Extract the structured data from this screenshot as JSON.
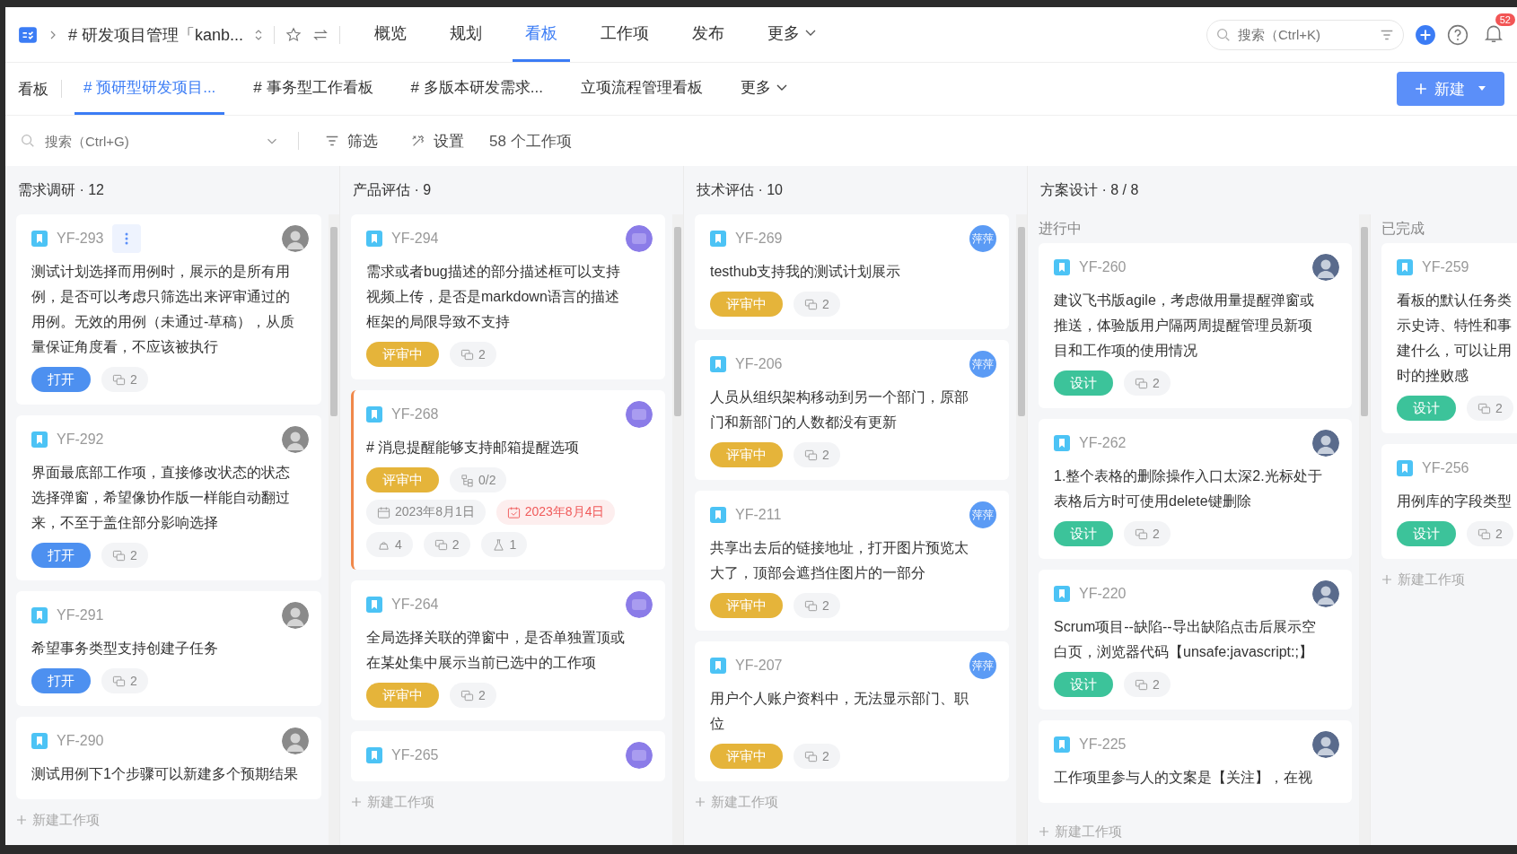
{
  "topbar": {
    "breadcrumb": "# 研发项目管理「kanb...",
    "nav": [
      {
        "label": "概览",
        "selected": false,
        "dropdown": false
      },
      {
        "label": "规划",
        "selected": false,
        "dropdown": false
      },
      {
        "label": "看板",
        "selected": true,
        "dropdown": false
      },
      {
        "label": "工作项",
        "selected": false,
        "dropdown": false
      },
      {
        "label": "发布",
        "selected": false,
        "dropdown": false
      },
      {
        "label": "更多",
        "selected": false,
        "dropdown": true
      }
    ],
    "search": {
      "placeholder": "搜索（Ctrl+K)"
    },
    "notifications": "52"
  },
  "board_tabs": {
    "label": "看板",
    "tabs": [
      {
        "label": "# 预研型研发项目...",
        "selected": true
      },
      {
        "label": "# 事务型工作看板",
        "selected": false
      },
      {
        "label": "# 多版本研发需求...",
        "selected": false
      },
      {
        "label": "立项流程管理看板",
        "selected": false
      }
    ],
    "more": "更多",
    "new_button": "新建"
  },
  "filter_bar": {
    "search": {
      "placeholder": "搜索（Ctrl+G)"
    },
    "filter": "筛选",
    "settings": "设置",
    "count": "58 个工作项"
  },
  "columns": [
    {
      "title": "需求调研 · 12",
      "lanes": [
        {
          "add": "新建工作项",
          "cards": [
            {
              "id": "YF-293",
              "menu": true,
              "flagged": false,
              "avatar": {
                "kind": "photo"
              },
              "lines": [
                "测试计划选择而用例时，展示的是所有用",
                "例，是否可以考虑只筛选出来评审通过的",
                "用例。无效的用例（未通过-草稿），从质",
                "量保证角度看，不应该被执行"
              ],
              "status": {
                "label": "打开",
                "kind": "open"
              },
              "comments": "2"
            },
            {
              "id": "YF-292",
              "menu": false,
              "flagged": false,
              "avatar": {
                "kind": "photo"
              },
              "lines": [
                "界面最底部工作项，直接修改状态的状态",
                "选择弹窗，希望像协作版一样能自动翻过",
                "来，不至于盖住部分影响选择"
              ],
              "status": {
                "label": "打开",
                "kind": "open"
              },
              "comments": "2"
            },
            {
              "id": "YF-291",
              "menu": false,
              "flagged": false,
              "avatar": {
                "kind": "photo"
              },
              "lines": [
                "希望事务类型支持创建子任务"
              ],
              "status": {
                "label": "打开",
                "kind": "open"
              },
              "comments": "2"
            },
            {
              "id": "YF-290",
              "menu": false,
              "flagged": false,
              "avatar": {
                "kind": "photo"
              },
              "lines": [
                "测试用例下1个步骤可以新建多个预期结果"
              ]
            }
          ]
        }
      ]
    },
    {
      "title": "产品评估 · 9",
      "lanes": [
        {
          "add": "新建工作项",
          "cards": [
            {
              "id": "YF-294",
              "menu": false,
              "flagged": false,
              "avatar": {
                "kind": "blurred"
              },
              "lines": [
                "需求或者bug描述的部分描述框可以支持",
                "视频上传，是否是markdown语言的描述",
                "框架的局限导致不支持"
              ],
              "status": {
                "label": "评审中",
                "kind": "review"
              },
              "comments": "2"
            },
            {
              "id": "YF-268",
              "menu": false,
              "flagged": true,
              "avatar": {
                "kind": "blurred"
              },
              "lines": [
                "# 消息提醒能够支持邮箱提醒选项"
              ],
              "status": {
                "label": "评审中",
                "kind": "review"
              },
              "subtasks": "0/2",
              "start": "2023年8月1日",
              "due": "2023年8月4日",
              "stats": [
                {
                  "kind": "like",
                  "value": "4"
                },
                {
                  "kind": "comment",
                  "value": "2"
                },
                {
                  "kind": "test",
                  "value": "1"
                }
              ]
            },
            {
              "id": "YF-264",
              "menu": false,
              "flagged": false,
              "avatar": {
                "kind": "blurred"
              },
              "lines": [
                "全局选择关联的弹窗中，是否单独置顶或",
                "在某处集中展示当前已选中的工作项"
              ],
              "status": {
                "label": "评审中",
                "kind": "review"
              },
              "comments": "2"
            },
            {
              "id": "YF-265",
              "menu": false,
              "flagged": false,
              "avatar": {
                "kind": "blurred"
              }
            }
          ]
        }
      ]
    },
    {
      "title": "技术评估 · 10",
      "lanes": [
        {
          "add": "新建工作项",
          "cards": [
            {
              "id": "YF-269",
              "menu": false,
              "flagged": false,
              "avatar": {
                "kind": "initials",
                "text": "萍萍"
              },
              "lines": [
                "testhub支持我的测试计划展示"
              ],
              "status": {
                "label": "评审中",
                "kind": "review"
              },
              "comments": "2"
            },
            {
              "id": "YF-206",
              "menu": false,
              "flagged": false,
              "avatar": {
                "kind": "initials",
                "text": "萍萍"
              },
              "lines": [
                "人员从组织架构移动到另一个部门，原部",
                "门和新部门的人数都没有更新"
              ],
              "status": {
                "label": "评审中",
                "kind": "review"
              },
              "comments": "2"
            },
            {
              "id": "YF-211",
              "menu": false,
              "flagged": false,
              "avatar": {
                "kind": "initials",
                "text": "萍萍"
              },
              "lines": [
                "共享出去后的链接地址，打开图片预览太",
                "大了，顶部会遮挡住图片的一部分"
              ],
              "status": {
                "label": "评审中",
                "kind": "review"
              },
              "comments": "2"
            },
            {
              "id": "YF-207",
              "menu": false,
              "flagged": false,
              "avatar": {
                "kind": "initials",
                "text": "萍萍"
              },
              "lines": [
                "用户个人账户资料中，无法显示部门、职",
                "位"
              ],
              "status": {
                "label": "评审中",
                "kind": "review"
              },
              "comments": "2"
            }
          ]
        }
      ]
    },
    {
      "title": "方案设计 · 8 / 8",
      "lanes": [
        {
          "title": "进行中",
          "add": "新建工作项",
          "cards": [
            {
              "id": "YF-260",
              "menu": false,
              "flagged": false,
              "avatar": {
                "kind": "person"
              },
              "lines": [
                "建议飞书版agile，考虑做用量提醒弹窗或",
                "推送，体验版用户隔两周提醒管理员新项",
                "目和工作项的使用情况"
              ],
              "status": {
                "label": "设计",
                "kind": "design"
              },
              "comments": "2"
            },
            {
              "id": "YF-262",
              "menu": false,
              "flagged": false,
              "avatar": {
                "kind": "person"
              },
              "lines": [
                "1.整个表格的删除操作入口太深2.光标处于",
                "表格后方时可使用delete键删除"
              ],
              "status": {
                "label": "设计",
                "kind": "design"
              },
              "comments": "2"
            },
            {
              "id": "YF-220",
              "menu": false,
              "flagged": false,
              "avatar": {
                "kind": "person"
              },
              "lines": [
                "Scrum项目--缺陷--导出缺陷点击后展示空",
                "白页，浏览器代码【unsafe:javascript:;】"
              ],
              "status": {
                "label": "设计",
                "kind": "design"
              },
              "comments": "2"
            },
            {
              "id": "YF-225",
              "menu": false,
              "flagged": false,
              "avatar": {
                "kind": "person"
              },
              "lines": [
                "工作项里参与人的文案是【关注】，在视"
              ]
            }
          ]
        },
        {
          "title": "已完成",
          "add": "新建工作项",
          "cards": [
            {
              "id": "YF-259",
              "menu": false,
              "flagged": false,
              "lines": [
                "看板的默认任务类",
                "示史诗、特性和事",
                "建什么，可以让用",
                "时的挫败感"
              ],
              "status": {
                "label": "设计",
                "kind": "design"
              },
              "comments": "2"
            },
            {
              "id": "YF-256",
              "menu": false,
              "flagged": false,
              "lines": [
                "用例库的字段类型"
              ],
              "status": {
                "label": "设计",
                "kind": "design"
              },
              "comments": "2"
            }
          ]
        }
      ]
    }
  ]
}
